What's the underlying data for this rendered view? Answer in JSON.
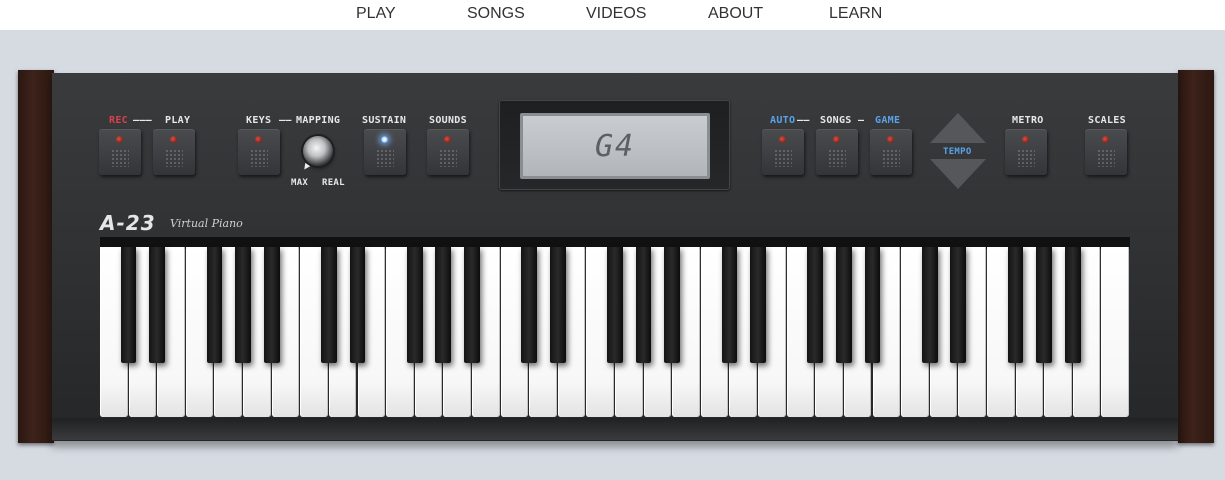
{
  "nav": {
    "items": [
      {
        "label": "PLAY"
      },
      {
        "label": "SONGS"
      },
      {
        "label": "VIDEOS"
      },
      {
        "label": "ABOUT"
      },
      {
        "label": "LEARN"
      }
    ]
  },
  "panel": {
    "rec": "REC",
    "play": "PLAY",
    "keys": "KEYS",
    "mapping": "MAPPING",
    "max": "MAX",
    "real": "REAL",
    "sustain": "SUSTAIN",
    "sounds": "SOUNDS",
    "auto": "AUTO",
    "songs": "SONGS",
    "game": "GAME",
    "tempo": "TEMPO",
    "metro": "METRO",
    "scales": "SCALES"
  },
  "display": {
    "value": "G4"
  },
  "brand": {
    "model": "A-23",
    "subtitle": "Virtual Piano"
  },
  "keyboard": {
    "white_keys": 36,
    "octaves": 5,
    "sustain_on": true
  },
  "colors": {
    "rec_red": "#d9414a",
    "accent_blue": "#5aa3e8",
    "body": "#2f3032",
    "wood": "#3d2219"
  }
}
